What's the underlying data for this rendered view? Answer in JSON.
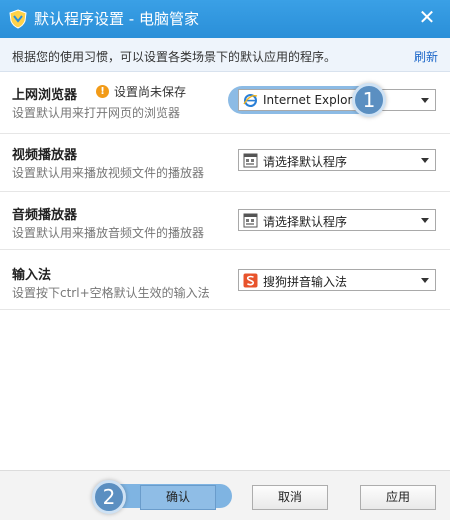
{
  "window": {
    "title": "默认程序设置 - 电脑管家",
    "close_glyph": "✕"
  },
  "info": {
    "text": "根据您的使用习惯，可以设置各类场景下的默认应用的程序。",
    "refresh": "刷新"
  },
  "rows": [
    {
      "title": "上网浏览器",
      "warning": "设置尚未保存",
      "warning_glyph": "!",
      "description": "设置默认用来打开网页的浏览器",
      "selected": "Internet Explorer",
      "icon": "ie-icon"
    },
    {
      "title": "视频播放器",
      "description": "设置默认用来播放视频文件的播放器",
      "selected": "请选择默认程序",
      "icon": "program-icon"
    },
    {
      "title": "音频播放器",
      "description": "设置默认用来播放音频文件的播放器",
      "selected": "请选择默认程序",
      "icon": "program-icon"
    },
    {
      "title": "输入法",
      "description": "设置按下ctrl+空格默认生效的输入法",
      "selected": "搜狗拼音输入法",
      "icon": "sogou-icon"
    }
  ],
  "badges": {
    "first": "1",
    "second": "2"
  },
  "footer": {
    "confirm": "确认",
    "cancel": "取消",
    "apply": "应用"
  },
  "colors": {
    "titlebar": "#2a8fd8",
    "highlight": "#7fb4e2",
    "badge": "#5b8fc1",
    "warning": "#f29b18",
    "link": "#1b66c9"
  }
}
